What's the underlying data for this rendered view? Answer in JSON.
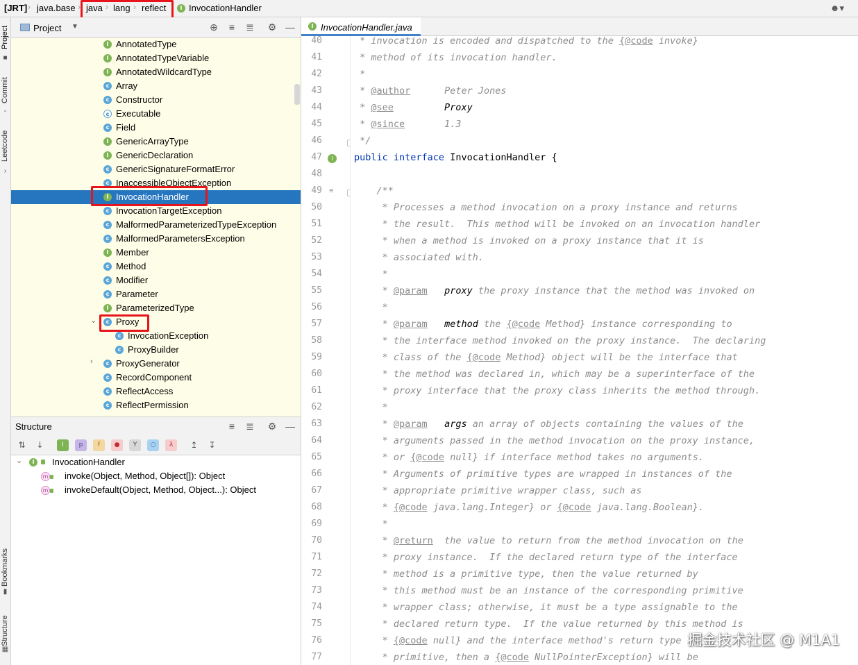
{
  "breadcrumb": {
    "items": [
      "[JRT]",
      "java.base",
      "java",
      "lang",
      "reflect",
      "InvocationHandler"
    ],
    "current_icon": "interface-icon"
  },
  "tool_strip": {
    "tabs": [
      "Project",
      "Commit",
      "Leetcode",
      "Bookmarks",
      "Structure"
    ]
  },
  "project_panel": {
    "title": "Project",
    "tree": [
      {
        "label": "AnnotatedType",
        "kind": "interface"
      },
      {
        "label": "AnnotatedTypeVariable",
        "kind": "interface"
      },
      {
        "label": "AnnotatedWildcardType",
        "kind": "interface"
      },
      {
        "label": "Array",
        "kind": "class"
      },
      {
        "label": "Constructor",
        "kind": "class"
      },
      {
        "label": "Executable",
        "kind": "abstract-class"
      },
      {
        "label": "Field",
        "kind": "class"
      },
      {
        "label": "GenericArrayType",
        "kind": "interface"
      },
      {
        "label": "GenericDeclaration",
        "kind": "interface"
      },
      {
        "label": "GenericSignatureFormatError",
        "kind": "class"
      },
      {
        "label": "InaccessibleObjectException",
        "kind": "class"
      },
      {
        "label": "InvocationHandler",
        "kind": "interface",
        "selected": true
      },
      {
        "label": "InvocationTargetException",
        "kind": "class"
      },
      {
        "label": "MalformedParameterizedTypeException",
        "kind": "class"
      },
      {
        "label": "MalformedParametersException",
        "kind": "class"
      },
      {
        "label": "Member",
        "kind": "interface"
      },
      {
        "label": "Method",
        "kind": "class"
      },
      {
        "label": "Modifier",
        "kind": "class"
      },
      {
        "label": "Parameter",
        "kind": "class"
      },
      {
        "label": "ParameterizedType",
        "kind": "interface"
      },
      {
        "label": "Proxy",
        "kind": "class",
        "expanded": true
      },
      {
        "label": "InvocationException",
        "kind": "class",
        "child": true
      },
      {
        "label": "ProxyBuilder",
        "kind": "class",
        "child": true
      },
      {
        "label": "ProxyGenerator",
        "kind": "class",
        "collapsed": true
      },
      {
        "label": "RecordComponent",
        "kind": "class"
      },
      {
        "label": "ReflectAccess",
        "kind": "class"
      },
      {
        "label": "ReflectPermission",
        "kind": "class"
      }
    ]
  },
  "structure_panel": {
    "title": "Structure",
    "root": "InvocationHandler",
    "members": [
      "invoke(Object, Method, Object[]): Object",
      "invokeDefault(Object, Method, Object...): Object"
    ]
  },
  "editor": {
    "tab_label": "InvocationHandler.java",
    "first_line_number": 40,
    "lines": [
      [
        {
          "t": " * ",
          "c": "cm"
        },
        {
          "t": "invocation is encoded and dispatched to the ",
          "c": "cm"
        },
        {
          "t": "{@code",
          "c": "tag"
        },
        {
          "t": " invoke}",
          "c": "cm"
        }
      ],
      [
        {
          "t": " * method of its invocation handler.",
          "c": "cm"
        }
      ],
      [
        {
          "t": " *",
          "c": "cm"
        }
      ],
      [
        {
          "t": " * ",
          "c": "cm"
        },
        {
          "t": "@author",
          "c": "tag"
        },
        {
          "t": "      Peter Jones",
          "c": "cm"
        }
      ],
      [
        {
          "t": " * ",
          "c": "cm"
        },
        {
          "t": "@see",
          "c": "tag"
        },
        {
          "t": "         Proxy",
          "c": "inl"
        }
      ],
      [
        {
          "t": " * ",
          "c": "cm"
        },
        {
          "t": "@since",
          "c": "tag"
        },
        {
          "t": "       1.3",
          "c": "cm"
        }
      ],
      [
        {
          "t": " */",
          "c": "cm"
        }
      ],
      [
        {
          "t": "public ",
          "c": "kw"
        },
        {
          "t": "interface ",
          "c": "kw"
        },
        {
          "t": "InvocationHandler {",
          "c": "ty"
        }
      ],
      [
        {
          "t": "",
          "c": "cm"
        }
      ],
      [
        {
          "t": "    /**",
          "c": "cm"
        }
      ],
      [
        {
          "t": "     * Processes a method invocation on a proxy instance and returns",
          "c": "cm"
        }
      ],
      [
        {
          "t": "     * the result.  This method will be invoked on an invocation handler",
          "c": "cm"
        }
      ],
      [
        {
          "t": "     * when a method is invoked on a proxy instance that it is",
          "c": "cm"
        }
      ],
      [
        {
          "t": "     * associated with.",
          "c": "cm"
        }
      ],
      [
        {
          "t": "     *",
          "c": "cm"
        }
      ],
      [
        {
          "t": "     * ",
          "c": "cm"
        },
        {
          "t": "@param",
          "c": "tag"
        },
        {
          "t": "   ",
          "c": "cm"
        },
        {
          "t": "proxy",
          "c": "inl"
        },
        {
          "t": " the proxy instance that the method was invoked on",
          "c": "cm"
        }
      ],
      [
        {
          "t": "     *",
          "c": "cm"
        }
      ],
      [
        {
          "t": "     * ",
          "c": "cm"
        },
        {
          "t": "@param",
          "c": "tag"
        },
        {
          "t": "   ",
          "c": "cm"
        },
        {
          "t": "method",
          "c": "inl"
        },
        {
          "t": " the ",
          "c": "cm"
        },
        {
          "t": "{@code",
          "c": "tag"
        },
        {
          "t": " Method}",
          "c": "cm"
        },
        {
          "t": " instance corresponding to",
          "c": "cm"
        }
      ],
      [
        {
          "t": "     * the interface method invoked on the proxy instance.  The declaring",
          "c": "cm"
        }
      ],
      [
        {
          "t": "     * class of the ",
          "c": "cm"
        },
        {
          "t": "{@code",
          "c": "tag"
        },
        {
          "t": " Method}",
          "c": "cm"
        },
        {
          "t": " object will be the interface that",
          "c": "cm"
        }
      ],
      [
        {
          "t": "     * the method was declared in, which may be a superinterface of the",
          "c": "cm"
        }
      ],
      [
        {
          "t": "     * proxy interface that the proxy class inherits the method through.",
          "c": "cm"
        }
      ],
      [
        {
          "t": "     *",
          "c": "cm"
        }
      ],
      [
        {
          "t": "     * ",
          "c": "cm"
        },
        {
          "t": "@param",
          "c": "tag"
        },
        {
          "t": "   ",
          "c": "cm"
        },
        {
          "t": "args",
          "c": "inl"
        },
        {
          "t": " an array of objects containing the values of the",
          "c": "cm"
        }
      ],
      [
        {
          "t": "     * arguments passed in the method invocation on the proxy instance,",
          "c": "cm"
        }
      ],
      [
        {
          "t": "     * or ",
          "c": "cm"
        },
        {
          "t": "{@code",
          "c": "tag"
        },
        {
          "t": " null}",
          "c": "cm"
        },
        {
          "t": " if interface method takes no arguments.",
          "c": "cm"
        }
      ],
      [
        {
          "t": "     * Arguments of primitive types are wrapped in instances of the",
          "c": "cm"
        }
      ],
      [
        {
          "t": "     * appropriate primitive wrapper class, such as",
          "c": "cm"
        }
      ],
      [
        {
          "t": "     * ",
          "c": "cm"
        },
        {
          "t": "{@code",
          "c": "tag"
        },
        {
          "t": " java.lang.Integer}",
          "c": "cm"
        },
        {
          "t": " or ",
          "c": "cm"
        },
        {
          "t": "{@code",
          "c": "tag"
        },
        {
          "t": " java.lang.Boolean}",
          "c": "cm"
        },
        {
          "t": ".",
          "c": "cm"
        }
      ],
      [
        {
          "t": "     *",
          "c": "cm"
        }
      ],
      [
        {
          "t": "     * ",
          "c": "cm"
        },
        {
          "t": "@return",
          "c": "tag"
        },
        {
          "t": "  the value to return from the method invocation on the",
          "c": "cm"
        }
      ],
      [
        {
          "t": "     * proxy instance.  If the declared return type of the interface",
          "c": "cm"
        }
      ],
      [
        {
          "t": "     * method is a primitive type, then the value returned by",
          "c": "cm"
        }
      ],
      [
        {
          "t": "     * this method must be an instance of the corresponding primitive",
          "c": "cm"
        }
      ],
      [
        {
          "t": "     * wrapper class; otherwise, it must be a type assignable to the",
          "c": "cm"
        }
      ],
      [
        {
          "t": "     * declared return type.  If the value returned by this method is",
          "c": "cm"
        }
      ],
      [
        {
          "t": "     * ",
          "c": "cm"
        },
        {
          "t": "{@code",
          "c": "tag"
        },
        {
          "t": " null}",
          "c": "cm"
        },
        {
          "t": " and the interface method's return type is",
          "c": "cm"
        }
      ],
      [
        {
          "t": "     * primitive, then a ",
          "c": "cm"
        },
        {
          "t": "{@code",
          "c": "tag"
        },
        {
          "t": " NullPointerException}",
          "c": "cm"
        },
        {
          "t": " will be",
          "c": "cm"
        }
      ]
    ]
  },
  "watermark": "掘金技术社区 @ M1A1",
  "colors": {
    "selection": "#2675bf",
    "highlight_box": "#e8141b",
    "tree_bg": "#fefee8",
    "keyword": "#0033b3",
    "comment": "#8c8c8c"
  }
}
